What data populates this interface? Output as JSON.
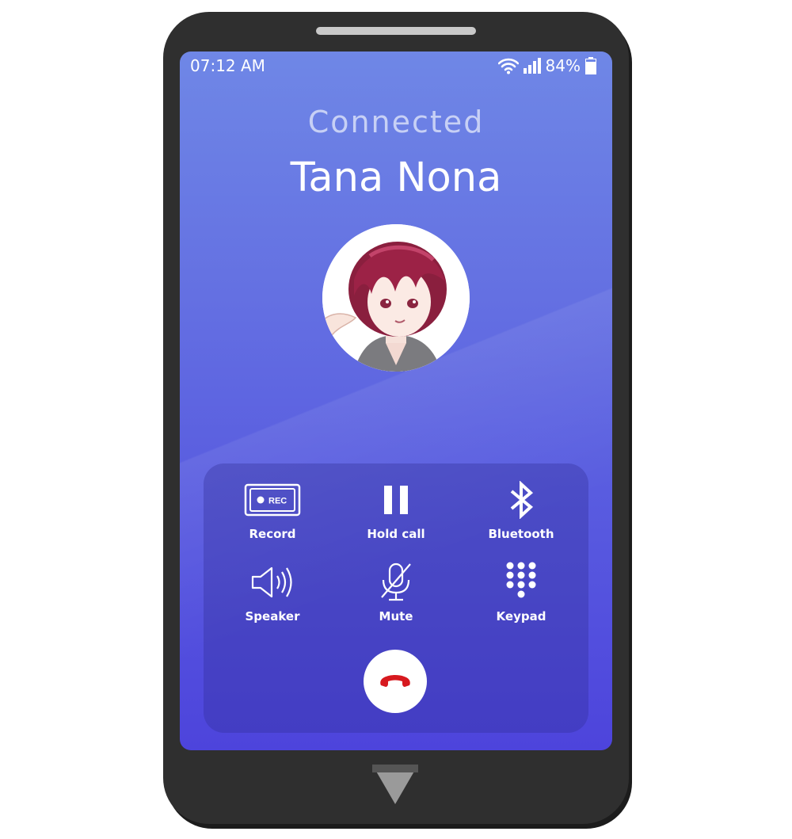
{
  "status_bar": {
    "time": "07:12 AM",
    "battery": "84%",
    "icons": [
      "wifi-icon",
      "signal-icon",
      "battery-icon"
    ]
  },
  "call": {
    "status": "Connected",
    "caller_name": "Tana Nona",
    "avatar_icon": "caller-avatar"
  },
  "controls": [
    {
      "label": "Record",
      "icon": "record-icon",
      "icon_text": "REC"
    },
    {
      "label": "Hold call",
      "icon": "pause-icon"
    },
    {
      "label": "Bluetooth",
      "icon": "bluetooth-icon"
    },
    {
      "label": "Speaker",
      "icon": "speaker-icon"
    },
    {
      "label": "Mute",
      "icon": "mic-off-icon"
    },
    {
      "label": "Keypad",
      "icon": "keypad-icon"
    }
  ],
  "end_call": {
    "icon": "end-call-icon"
  },
  "colors": {
    "screen_top": "#6f87e6",
    "screen_bottom": "#4d44dc",
    "end_call_red": "#d7191f",
    "frame": "#2f2f2f"
  }
}
